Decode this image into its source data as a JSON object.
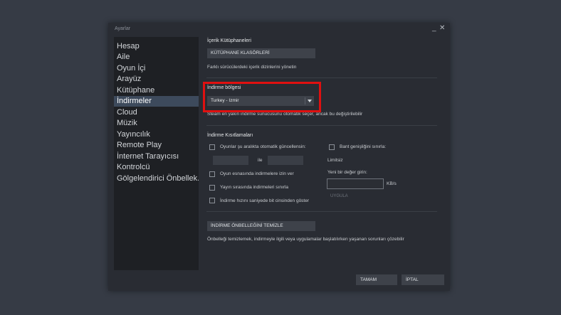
{
  "window": {
    "title": "Ayarlar",
    "minimize_glyph": "_",
    "close_glyph": "✕"
  },
  "sidebar": {
    "items": [
      {
        "label": "Hesap"
      },
      {
        "label": "Aile"
      },
      {
        "label": "Oyun İçi"
      },
      {
        "label": "Arayüz"
      },
      {
        "label": "Kütüphane"
      },
      {
        "label": "İndirmeler"
      },
      {
        "label": "Cloud"
      },
      {
        "label": "Müzik"
      },
      {
        "label": "Yayıncılık"
      },
      {
        "label": "Remote Play"
      },
      {
        "label": "İnternet Tarayıcısı"
      },
      {
        "label": "Kontrolcü"
      },
      {
        "label": "Gölgelendirici Önbellek..."
      }
    ],
    "active_index": 5
  },
  "content_libraries": {
    "title": "İçerik Kütüphaneleri",
    "button": "KÜTÜPHANE KLASÖRLERİ",
    "desc": "Farklı sürücülerdeki içerik dizinlerini yönetin"
  },
  "download_region": {
    "title": "İndirme bölgesi",
    "value": "Turkey - Izmir",
    "desc": "Steam en yakın indirme sunucusunu otomatik seçer, ancak bu değiştirilebilir",
    "highlight_color": "#e01010"
  },
  "restrictions": {
    "title": "İndirme Kısıtlamaları",
    "auto_update_label": "Oyunlar şu aralıkta otomatik güncellensin:",
    "between_label": "ile",
    "allow_ingame_label": "Oyun esnasında indirmelere izin ver",
    "throttle_stream_label": "Yayın sırasında indirmeleri sınırla",
    "show_bits_label": "İndirme hızını saniyede bit cinsinden göster",
    "bandwidth_label": "Bant genişliğini sınırla:",
    "bandwidth_value": "Limitsiz",
    "new_value_label": "Yeni bir değer girin:",
    "unit_label": "KB/s",
    "apply_label": "UYGULA"
  },
  "cache": {
    "button": "İNDİRME ÖNBELLEĞİNİ TEMİZLE",
    "desc": "Önbelleği temizlemek, indirmeyle ilgili veya uygulamalar başlatılırken yaşanan sorunları çözebilir"
  },
  "footer": {
    "ok_label": "TAMAM",
    "cancel_label": "İPTAL"
  }
}
